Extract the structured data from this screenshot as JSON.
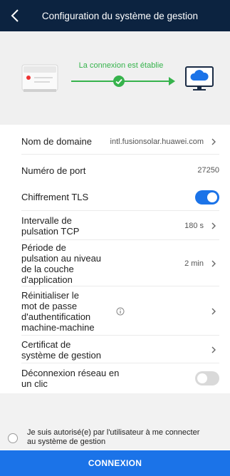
{
  "header": {
    "title": "Configuration du système de gestion"
  },
  "status": {
    "connection_text": "La connexion est établie",
    "color": "#36b34c"
  },
  "settings": {
    "domain": {
      "label": "Nom de domaine",
      "value": "intl.fusionsolar.huawei.com"
    },
    "port": {
      "label": "Numéro de port",
      "value": "27250"
    },
    "tls": {
      "label": "Chiffrement TLS",
      "enabled": true
    },
    "tcp_interval": {
      "label_line1": "Intervalle de",
      "label_line2": "pulsation TCP",
      "value": "180 s"
    },
    "app_period": {
      "label_line1": "Période de",
      "label_line2": "pulsation au niveau",
      "label_line3": "de la couche",
      "label_line4": "d'application",
      "value": "2 min"
    },
    "m2m_reset": {
      "label_line1": "Réinitialiser le",
      "label_line2": "mot de passe",
      "label_line3": "d'authentification",
      "label_line4": "machine-machine"
    },
    "certificate": {
      "label_line1": "Certificat de",
      "label_line2": "système de gestion"
    },
    "one_click_disconnect": {
      "label_line1": "Déconnexion réseau en",
      "label_line2": "un clic",
      "enabled": false
    }
  },
  "consent": {
    "text_line1": "Je suis autorisé(e) par l'utilisateur à me connecter",
    "text_line2": "au système de gestion",
    "checked": false
  },
  "footer": {
    "button_label": "CONNEXION"
  },
  "colors": {
    "header_bg": "#0c2340",
    "accent": "#1b73e8",
    "hero_bg": "#f0f0f0"
  },
  "icons": [
    "back-arrow-icon",
    "inverter-device-icon",
    "check-circle-icon",
    "cloud-monitor-icon",
    "chevron-right-icon",
    "info-icon"
  ]
}
